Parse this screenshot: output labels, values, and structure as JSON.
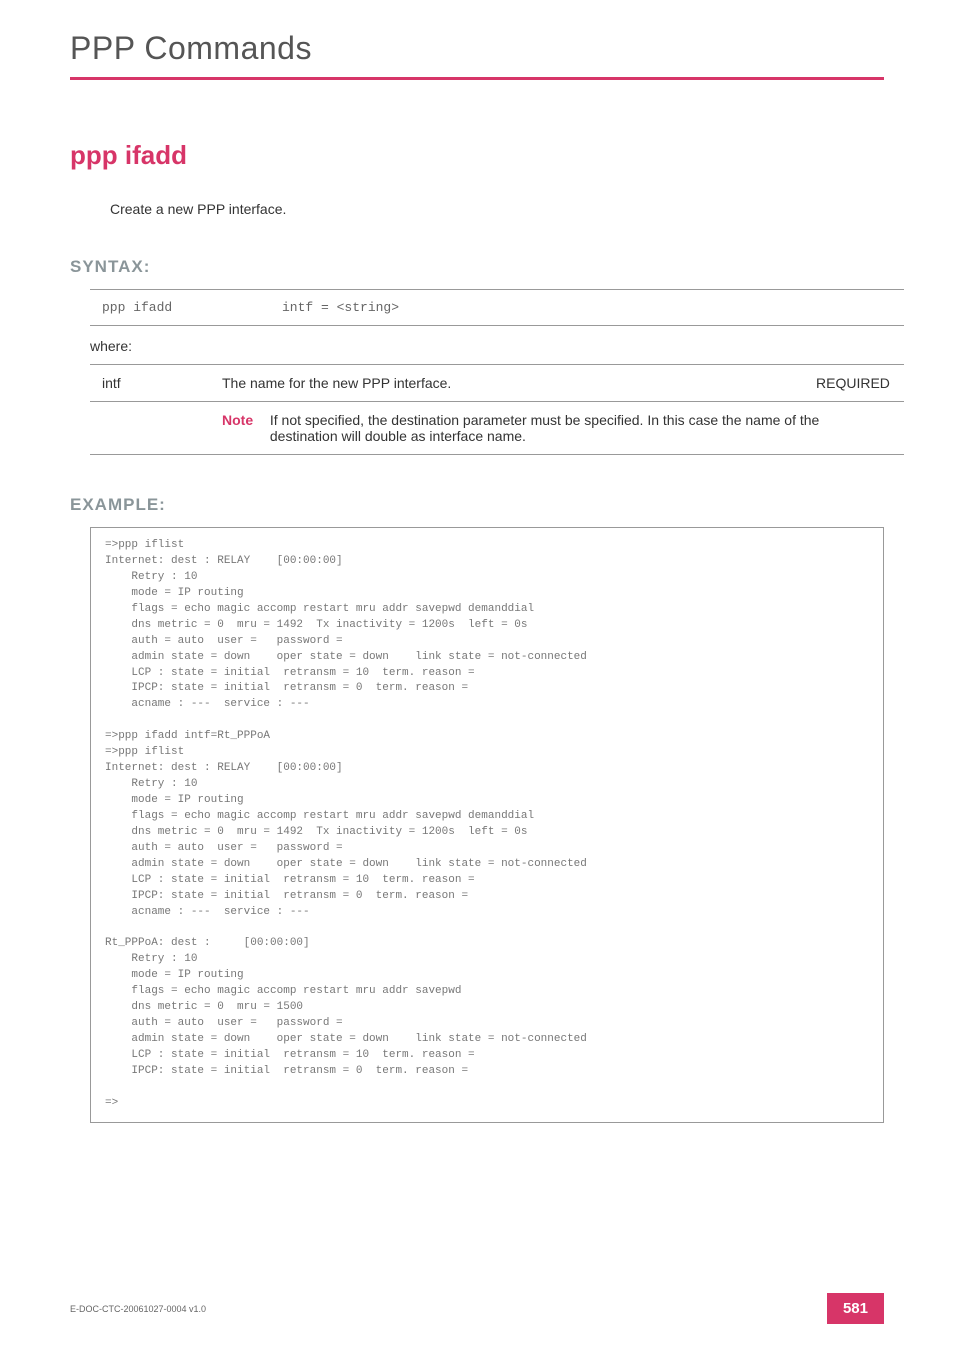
{
  "header": {
    "chapter": "PPP Commands"
  },
  "command": {
    "name": "ppp ifadd",
    "description": "Create a new PPP interface."
  },
  "syntax": {
    "heading": "SYNTAX:",
    "cmd": "ppp ifadd",
    "args": "intf = <string>",
    "where_label": "where:",
    "param": {
      "name": "intf",
      "desc": "The name for the new PPP interface.",
      "required": "REQUIRED",
      "note_label": "Note",
      "note_text": "If not specified, the destination parameter must be specified. In this case the name of the destination will double as interface name."
    }
  },
  "example": {
    "heading": "EXAMPLE:",
    "code": "=>ppp iflist\nInternet: dest : RELAY    [00:00:00]\n    Retry : 10\n    mode = IP routing\n    flags = echo magic accomp restart mru addr savepwd demanddial\n    dns metric = 0  mru = 1492  Tx inactivity = 1200s  left = 0s\n    auth = auto  user =   password =\n    admin state = down    oper state = down    link state = not-connected\n    LCP : state = initial  retransm = 10  term. reason =\n    IPCP: state = initial  retransm = 0  term. reason =\n    acname : ---  service : ---\n\n=>ppp ifadd intf=Rt_PPPoA\n=>ppp iflist\nInternet: dest : RELAY    [00:00:00]\n    Retry : 10\n    mode = IP routing\n    flags = echo magic accomp restart mru addr savepwd demanddial\n    dns metric = 0  mru = 1492  Tx inactivity = 1200s  left = 0s\n    auth = auto  user =   password =\n    admin state = down    oper state = down    link state = not-connected\n    LCP : state = initial  retransm = 10  term. reason =\n    IPCP: state = initial  retransm = 0  term. reason =\n    acname : ---  service : ---\n\nRt_PPPoA: dest :     [00:00:00]\n    Retry : 10\n    mode = IP routing\n    flags = echo magic accomp restart mru addr savepwd\n    dns metric = 0  mru = 1500\n    auth = auto  user =   password =\n    admin state = down    oper state = down    link state = not-connected\n    LCP : state = initial  retransm = 10  term. reason =\n    IPCP: state = initial  retransm = 0  term. reason =\n\n=>"
  },
  "footer": {
    "doc_id": "E-DOC-CTC-20061027-0004 v1.0",
    "page": "581"
  }
}
